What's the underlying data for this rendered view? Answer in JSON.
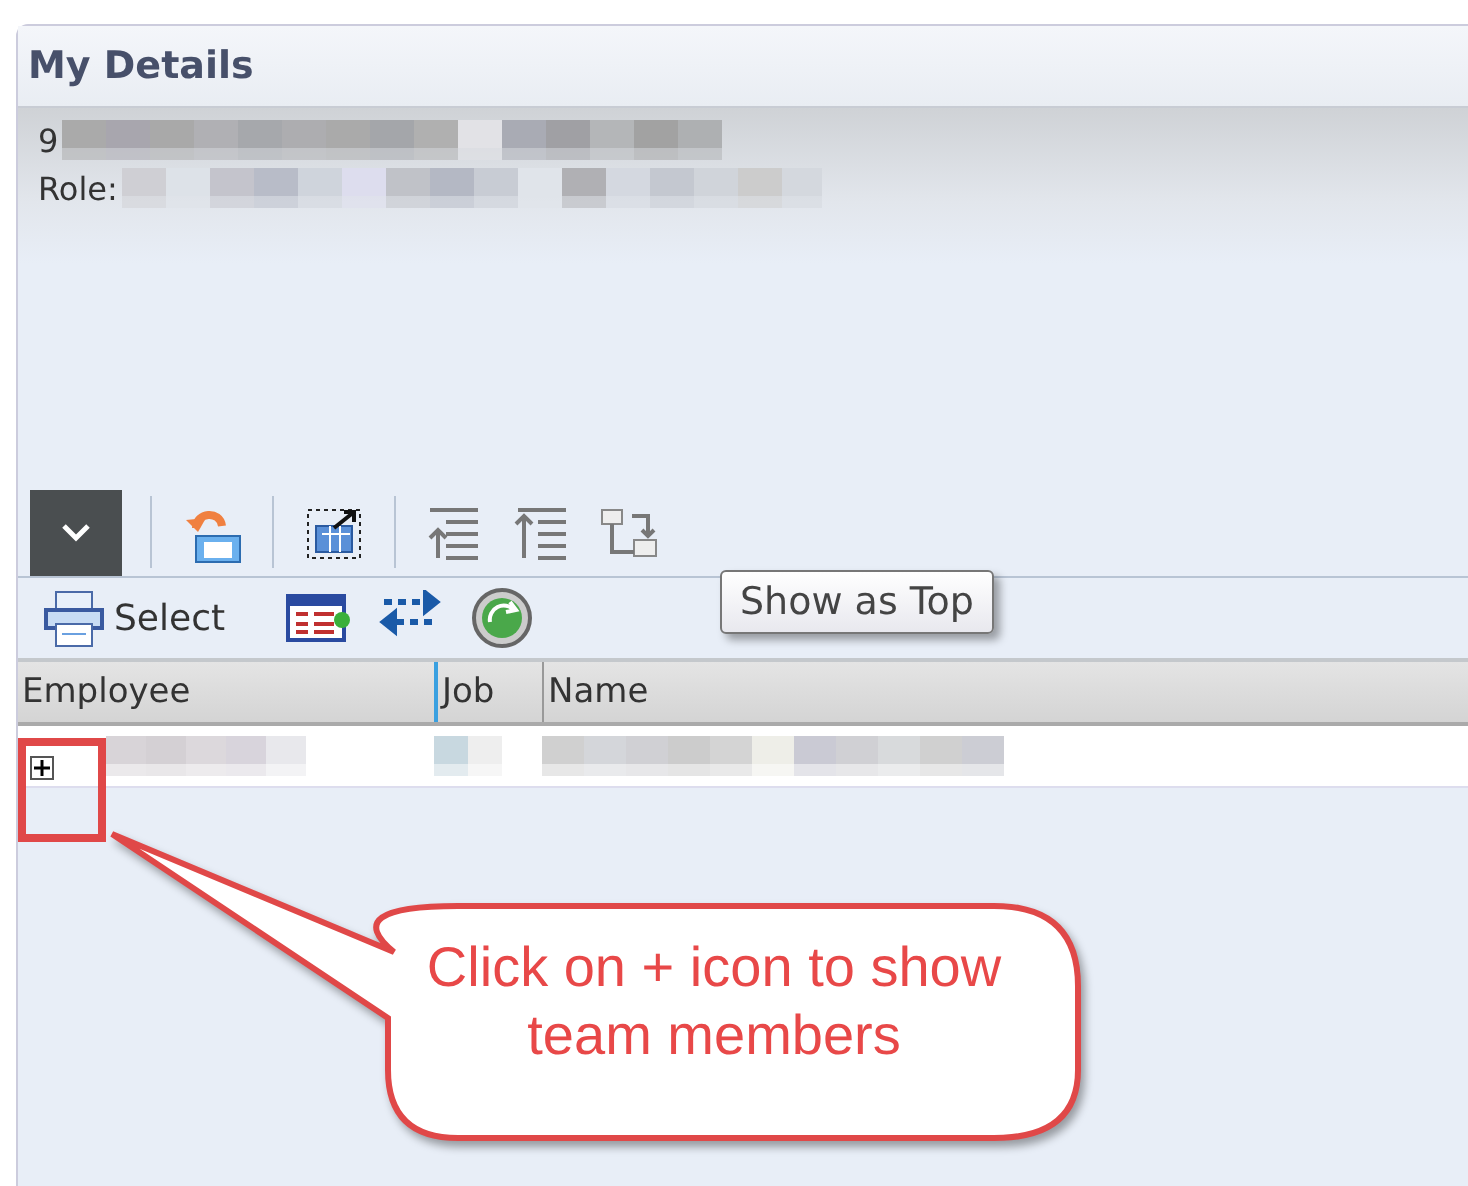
{
  "panel": {
    "title": "My Details",
    "id_prefix": "9",
    "role_label": "Role:"
  },
  "toolbar": {
    "select_button": "Select"
  },
  "tooltip": "Show as Top",
  "table": {
    "columns": [
      "Employee",
      "Job",
      "Name"
    ],
    "rows": [
      {
        "expanded": false
      }
    ]
  },
  "callout": {
    "text": "Click on + icon to show team members"
  }
}
